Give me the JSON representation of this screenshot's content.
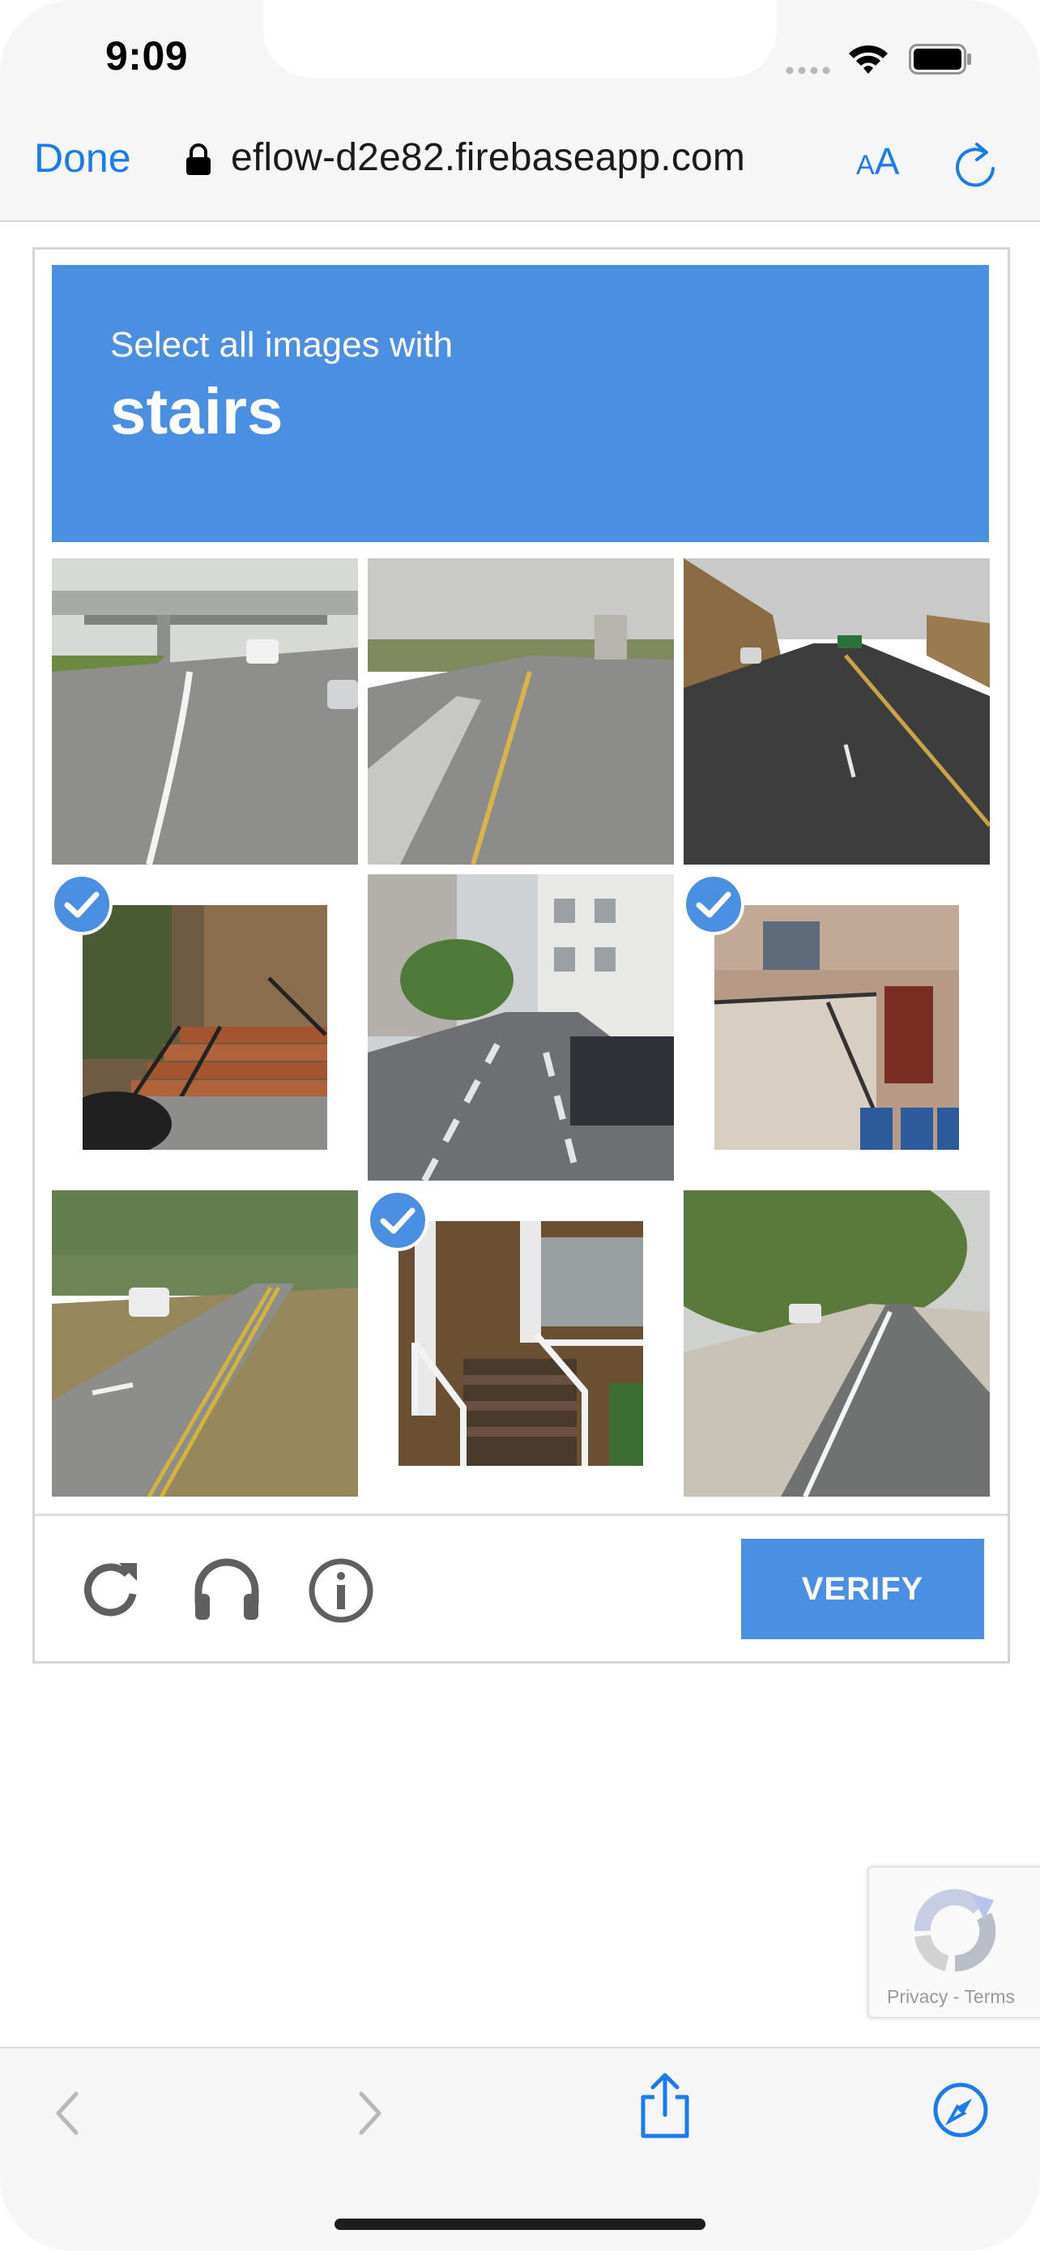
{
  "status_bar": {
    "time": "9:09"
  },
  "browser": {
    "done_label": "Done",
    "url": "eflow-d2e82.firebaseapp.com",
    "text_size_small": "A",
    "text_size_large": "A"
  },
  "captcha": {
    "instruction": "Select all images with",
    "target": "stairs",
    "tiles": [
      {
        "scene": "highway with overpass",
        "selected": false
      },
      {
        "scene": "road with truck",
        "selected": false
      },
      {
        "scene": "multi-lane highway",
        "selected": false
      },
      {
        "scene": "front steps with railing",
        "selected": true
      },
      {
        "scene": "city street with motorbikes",
        "selected": false
      },
      {
        "scene": "exterior stairs of brick house",
        "selected": true
      },
      {
        "scene": "road with bike lane",
        "selected": false
      },
      {
        "scene": "porch stairs",
        "selected": true
      },
      {
        "scene": "tree-lined road",
        "selected": false
      }
    ],
    "verify_label": "VERIFY",
    "accent_color": "#4a8fe2"
  },
  "badge": {
    "text": "Privacy - Terms"
  },
  "icons": {
    "status": [
      "signal-icon",
      "wifi-icon",
      "battery-icon"
    ],
    "browser": [
      "lock-icon",
      "reload-icon"
    ],
    "captcha": [
      "refresh-icon",
      "headphones-icon",
      "info-icon",
      "check-icon"
    ],
    "toolbar": [
      "back-icon",
      "forward-icon",
      "share-icon",
      "compass-icon"
    ]
  }
}
